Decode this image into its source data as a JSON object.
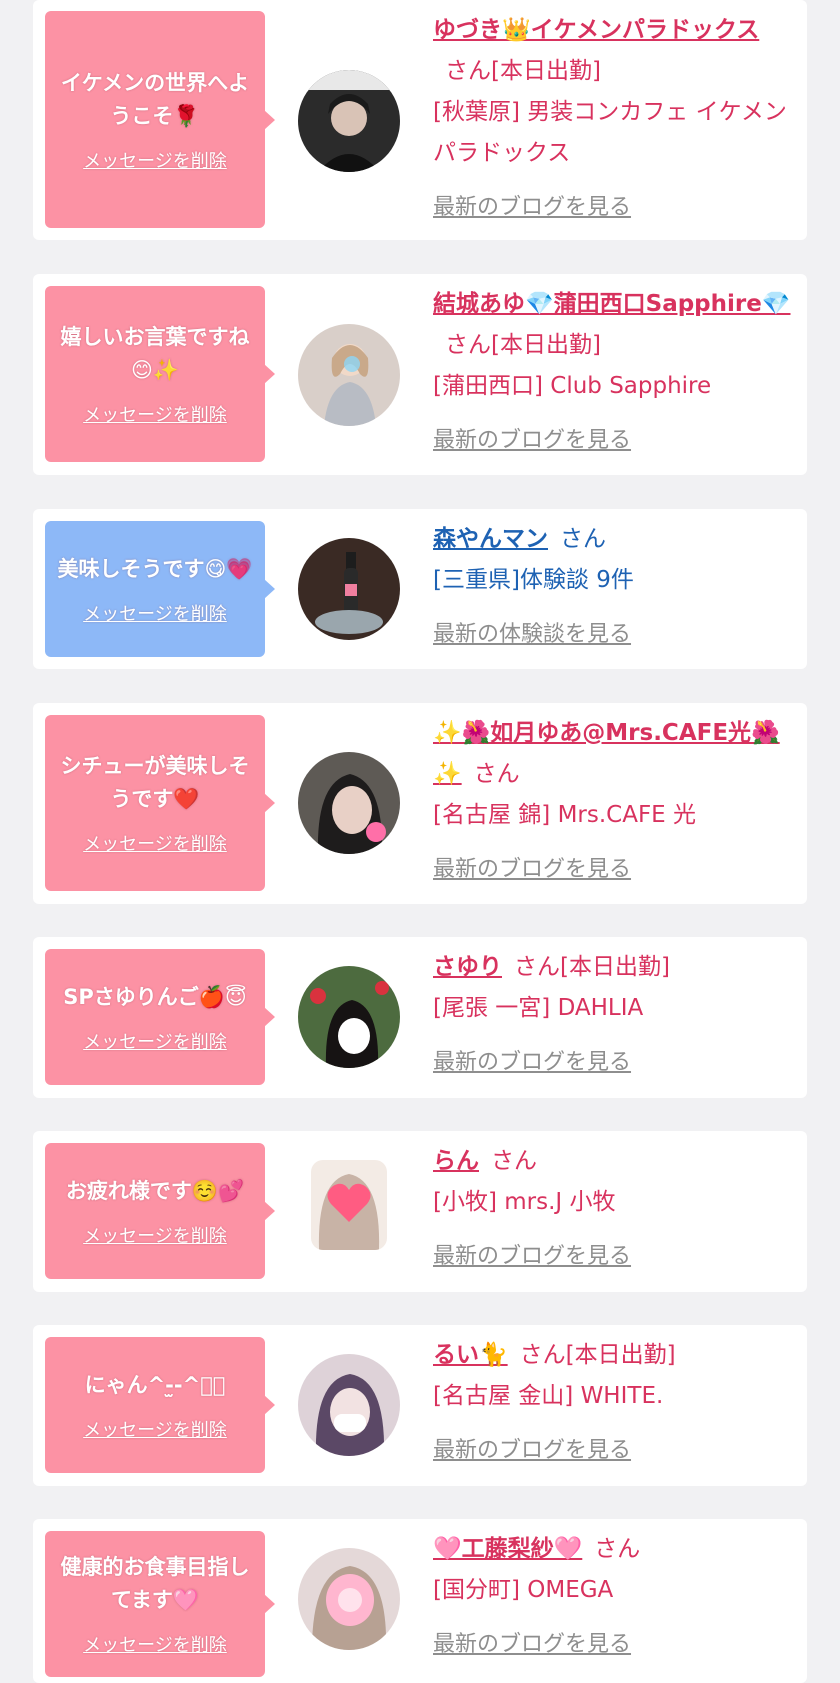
{
  "blog_link": "最新のブログを見る",
  "review_link": "最新の体験談を見る",
  "delete_label": "メッセージを削除",
  "items": [
    {
      "message": "イケメンの世界へようこそ🌹",
      "name": "ゆづき👑イケメンパラドックス",
      "suffix": "さん[本日出勤]",
      "shop": "[秋葉原] 男装コンカフェ イケメンパラドックス"
    },
    {
      "message": "嬉しいお言葉ですね😊✨",
      "name": "結城あゆ💎蒲田西口Sapphire💎",
      "suffix": "さん[本日出勤]",
      "shop": "[蒲田西口] Club Sapphire"
    },
    {
      "message": "美味しそうです😋💗",
      "name": "森やんマン",
      "suffix": "さん",
      "shop": "[三重県]体験談 9件"
    },
    {
      "message": "シチューが美味しそうです❤️",
      "name": "✨🌺如月ゆあ@Mrs.CAFE光🌺✨",
      "suffix": "さん",
      "shop": "[名古屋 錦] Mrs.CAFE 光"
    },
    {
      "message": "SPさゆりんご🍎😇",
      "name": "さゆり",
      "suffix": "さん[本日出勤]",
      "shop": "[尾張 一宮] DAHLIA"
    },
    {
      "message": "お疲れ様です☺️💕",
      "name": "らん",
      "suffix": "さん",
      "shop": "[小牧] mrs.J 小牧"
    },
    {
      "message": "にゃん^-̫-^ฅ゙",
      "name": "るい🐈",
      "suffix": "さん[本日出勤]",
      "shop": "[名古屋 金山] WHITE."
    },
    {
      "message": "健康的お食事目指してます🩷",
      "name": "🩷工藤梨紗🩷",
      "suffix": "さん",
      "shop": "[国分町] OMEGA"
    }
  ],
  "colors": {
    "page_bg": "#f1f1f3",
    "pink_bubble": "#fc92a4",
    "blue_bubble": "#8db8f7",
    "name_pink": "#d8325e",
    "name_blue": "#1e62b3",
    "link_gray": "#8e8e8e"
  }
}
